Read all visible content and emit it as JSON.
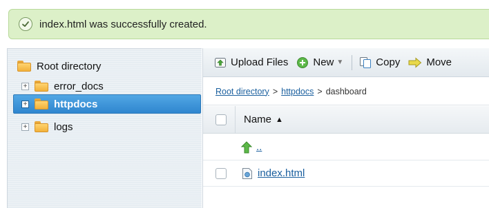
{
  "alert": {
    "message": "index.html was successfully created."
  },
  "tree": {
    "root_label": "Root directory",
    "items": [
      {
        "label": "error_docs",
        "expander": "+"
      },
      {
        "label": "httpdocs",
        "expander": "+"
      },
      {
        "label": "logs",
        "expander": "+"
      }
    ]
  },
  "toolbar": {
    "upload_label": "Upload Files",
    "new_label": "New",
    "copy_label": "Copy",
    "move_label": "Move"
  },
  "breadcrumb": {
    "root": "Root directory",
    "httpdocs": "httpdocs",
    "current": "dashboard",
    "separator": ">"
  },
  "table": {
    "name_header": "Name",
    "sort_indicator": "▲",
    "up_label": "..",
    "rows": [
      {
        "name": "index.html"
      }
    ]
  },
  "colors": {
    "accent": "#2f86cf",
    "success_bg": "#dcf0c8",
    "link": "#1a5f9e"
  }
}
